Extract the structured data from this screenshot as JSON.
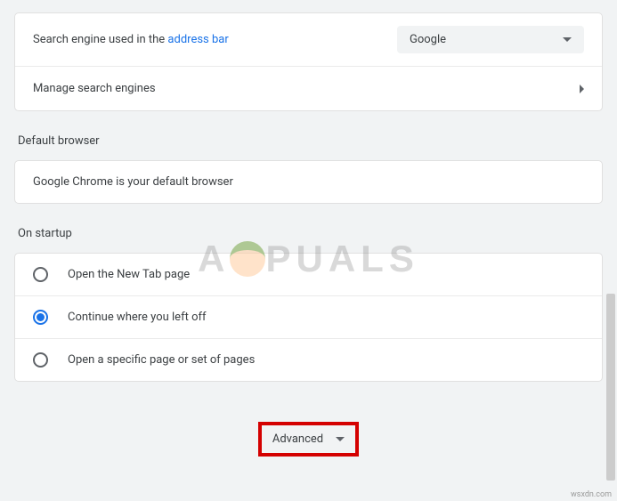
{
  "search_engine": {
    "label_prefix": "Search engine used in the ",
    "label_link": "address bar",
    "selected": "Google",
    "manage_label": "Manage search engines"
  },
  "default_browser": {
    "heading": "Default browser",
    "text": "Google Chrome is your default browser"
  },
  "startup": {
    "heading": "On startup",
    "options": [
      {
        "label": "Open the New Tab page",
        "selected": false
      },
      {
        "label": "Continue where you left off",
        "selected": true
      },
      {
        "label": "Open a specific page or set of pages",
        "selected": false
      }
    ]
  },
  "advanced": {
    "label": "Advanced"
  },
  "watermark": {
    "text_left": "A",
    "text_right": "PUALS"
  },
  "credit": "wsxdn.com"
}
